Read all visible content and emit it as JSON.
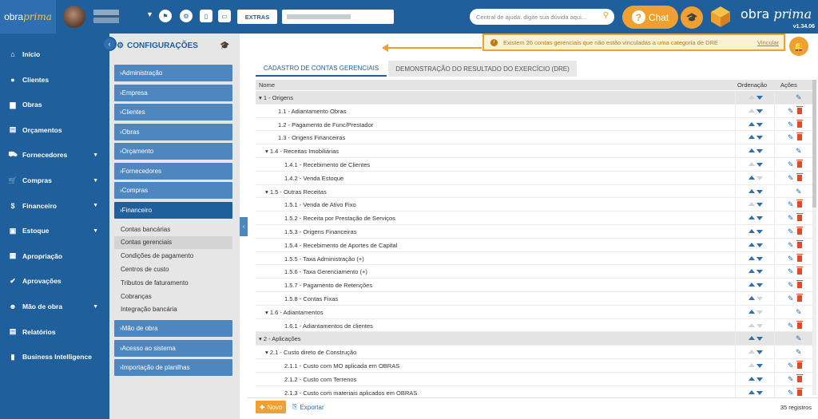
{
  "topbar": {
    "brand": {
      "part1": "obra",
      "part2": "prima"
    },
    "extras_label": "EXTRAS",
    "help_placeholder": "Central de ajuda: digite sua dúvida aqui...",
    "chat_label": "Chat",
    "logo": {
      "part1": "obra",
      "part2": "prima"
    },
    "version": "v1.34.06"
  },
  "sidebar": {
    "items": [
      {
        "label": "Início",
        "icon": "home-icon",
        "glyph": "⌂",
        "chevron": false
      },
      {
        "label": "Clientes",
        "icon": "user-icon",
        "glyph": "●",
        "chevron": false
      },
      {
        "label": "Obras",
        "icon": "building-icon",
        "glyph": "▆",
        "chevron": false
      },
      {
        "label": "Orçamentos",
        "icon": "document-icon",
        "glyph": "▤",
        "chevron": false
      },
      {
        "label": "Fornecedores",
        "icon": "truck-icon",
        "glyph": "⛟",
        "chevron": true
      },
      {
        "label": "Compras",
        "icon": "cart-icon",
        "glyph": "🛒",
        "chevron": true
      },
      {
        "label": "Financeiro",
        "icon": "dollar-icon",
        "glyph": "$",
        "chevron": true
      },
      {
        "label": "Estoque",
        "icon": "box-icon",
        "glyph": "▣",
        "chevron": true
      },
      {
        "label": "Apropriação",
        "icon": "report-icon",
        "glyph": "▦",
        "chevron": false
      },
      {
        "label": "Aprovações",
        "icon": "approval-icon",
        "glyph": "✔",
        "chevron": false
      },
      {
        "label": "Mão de obra",
        "icon": "workers-icon",
        "glyph": "☻",
        "chevron": true
      },
      {
        "label": "Relatórios",
        "icon": "file-icon",
        "glyph": "▤",
        "chevron": false
      },
      {
        "label": "Business Intelligence",
        "icon": "bar-chart-icon",
        "glyph": "▮",
        "chevron": false
      }
    ]
  },
  "config": {
    "title": "CONFIGURAÇÕES",
    "sections_top": [
      {
        "label": "Administração"
      },
      {
        "label": "Empresa"
      },
      {
        "label": "Clientes"
      },
      {
        "label": "Obras"
      },
      {
        "label": "Orçamento"
      },
      {
        "label": "Fornecedores"
      },
      {
        "label": "Compras"
      },
      {
        "label": "Financeiro"
      }
    ],
    "financeiro_subitems": [
      {
        "label": "Contas bancárias"
      },
      {
        "label": "Contas gerenciais"
      },
      {
        "label": "Condições de pagamento"
      },
      {
        "label": "Centros de custo"
      },
      {
        "label": "Tributos de faturamento"
      },
      {
        "label": "Cobranças"
      },
      {
        "label": "Integração bancária"
      }
    ],
    "sections_bottom": [
      {
        "label": "Mão de obra"
      },
      {
        "label": "Acesso ao sistema"
      },
      {
        "label": "Importação de planilhas"
      }
    ]
  },
  "alert": {
    "text": "Existem 26 contas gerenciais que não estão vinculadas a uma categoria de DRE",
    "link": "Vincular"
  },
  "tabs": [
    {
      "label": "CADASTRO DE CONTAS GERENCIAIS"
    },
    {
      "label": "DEMONSTRAÇÃO DO RESULTADO DO EXERCÍCIO (DRE)"
    }
  ],
  "grid": {
    "columns": {
      "name": "Nome",
      "order": "Ordenação",
      "actions": "Ações"
    },
    "rows": [
      {
        "label": "1 - Origens",
        "level": 0,
        "group": true,
        "up": false,
        "down": true,
        "delete": false
      },
      {
        "label": "1.1 - Adiantamento Obras",
        "level": 1,
        "group": false,
        "up": false,
        "down": true,
        "delete": true
      },
      {
        "label": "1.2 - Pagamento de Func/Prestador",
        "level": 1,
        "group": false,
        "up": true,
        "down": true,
        "delete": true
      },
      {
        "label": "1.3 - Origens Financeiras",
        "level": 1,
        "group": false,
        "up": true,
        "down": true,
        "delete": true
      },
      {
        "label": "1.4 - Receitas Imobiliárias",
        "level": 1,
        "group": true,
        "up": true,
        "down": true,
        "delete": false
      },
      {
        "label": "1.4.1 - Recebimento de Clientes",
        "level": 2,
        "group": false,
        "up": false,
        "down": true,
        "delete": true
      },
      {
        "label": "1.4.2 - Venda Estoque",
        "level": 2,
        "group": false,
        "up": true,
        "down": false,
        "delete": true
      },
      {
        "label": "1.5 - Outras Receitas",
        "level": 1,
        "group": true,
        "up": true,
        "down": true,
        "delete": false
      },
      {
        "label": "1.5.1 - Venda de Ativo Fixo",
        "level": 2,
        "group": false,
        "up": false,
        "down": true,
        "delete": true
      },
      {
        "label": "1.5.2 - Receita por Prestação de Serviços",
        "level": 2,
        "group": false,
        "up": true,
        "down": true,
        "delete": true
      },
      {
        "label": "1.5.3 - Origens Financeiras",
        "level": 2,
        "group": false,
        "up": true,
        "down": true,
        "delete": true
      },
      {
        "label": "1.5.4 - Recebimento de Aportes de Capital",
        "level": 2,
        "group": false,
        "up": true,
        "down": true,
        "delete": true
      },
      {
        "label": "1.5.5 - Taxa Administração (+)",
        "level": 2,
        "group": false,
        "up": true,
        "down": true,
        "delete": true
      },
      {
        "label": "1.5.6 - Taxa Gerenciamento (+)",
        "level": 2,
        "group": false,
        "up": true,
        "down": true,
        "delete": true
      },
      {
        "label": "1.5.7 - Pagamento de Retenções",
        "level": 2,
        "group": false,
        "up": true,
        "down": true,
        "delete": true
      },
      {
        "label": "1.5.8 - Contas Fixas",
        "level": 2,
        "group": false,
        "up": true,
        "down": false,
        "delete": true
      },
      {
        "label": "1.6 - Adiantamentos",
        "level": 1,
        "group": true,
        "up": true,
        "down": false,
        "delete": false
      },
      {
        "label": "1.6.1 - Adiantamentos de clientes",
        "level": 2,
        "group": false,
        "up": false,
        "down": false,
        "delete": true
      },
      {
        "label": "2 - Aplicações",
        "level": 0,
        "group": true,
        "up": true,
        "down": true,
        "delete": false
      },
      {
        "label": "2.1 - Custo direto de Construção",
        "level": 1,
        "group": true,
        "up": false,
        "down": true,
        "delete": false
      },
      {
        "label": "2.1.1 - Custo com MO aplicada em OBRAS",
        "level": 2,
        "group": false,
        "up": false,
        "down": true,
        "delete": true
      },
      {
        "label": "2.1.2 - Custo com Terrenos",
        "level": 2,
        "group": false,
        "up": true,
        "down": true,
        "delete": true
      },
      {
        "label": "2.1.3 - Custo com materiais aplicados em OBRAS",
        "level": 2,
        "group": false,
        "up": true,
        "down": true,
        "delete": true
      }
    ]
  },
  "footer": {
    "new_label": "Novo",
    "export_label": "Exportar",
    "count": "35 registros"
  },
  "colors": {
    "primary": "#1f5f9c",
    "secondary": "#4e86c0",
    "accent": "#f0a030",
    "delete": "#e04a2a"
  }
}
